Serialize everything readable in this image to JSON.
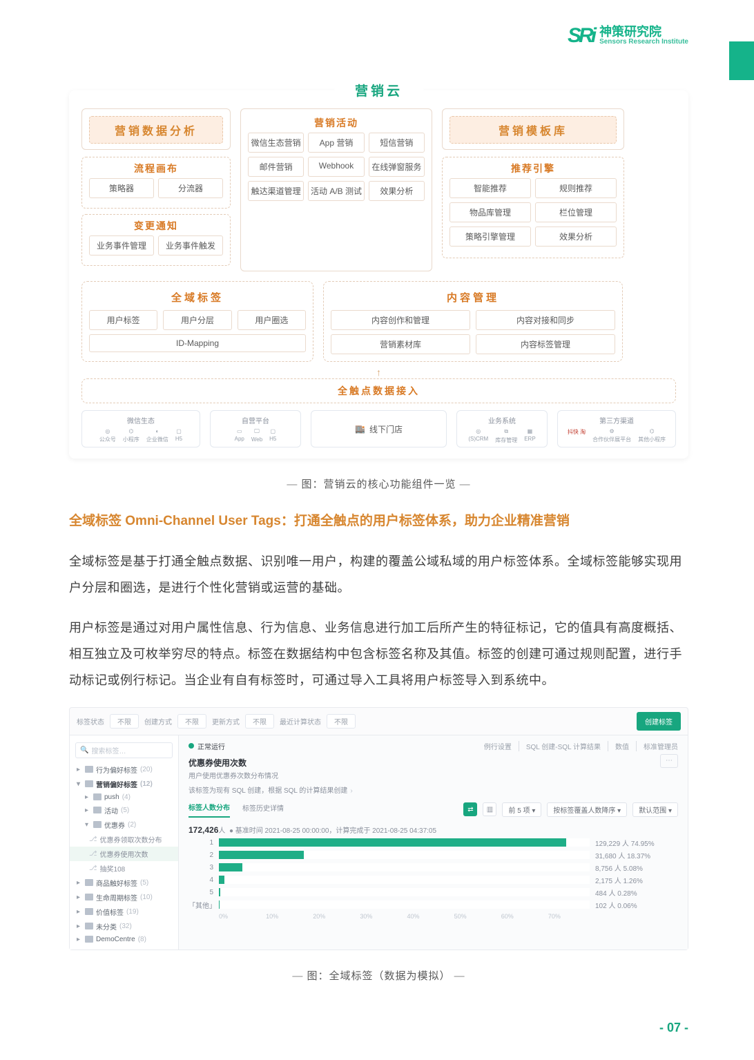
{
  "header": {
    "brand_cn": "神策研究院",
    "brand_en": "Sensors Research Institute",
    "brand_mark": "SRi"
  },
  "diagram": {
    "title": "营销云",
    "cols": {
      "analytics": {
        "header": "营销数据分析"
      },
      "templates": {
        "header": "营销模板库"
      },
      "canvas": {
        "title": "流程画布",
        "items": [
          "策略器",
          "分流器"
        ]
      },
      "change": {
        "title": "变更通知",
        "items": [
          "业务事件管理",
          "业务事件触发"
        ]
      },
      "activity": {
        "title": "营销活动",
        "items": [
          "微信生态营销",
          "App 营销",
          "短信营销",
          "邮件营销",
          "Webhook",
          "在线弹窗服务",
          "触达渠道管理",
          "活动 A/B 测试",
          "效果分析"
        ]
      },
      "recommend": {
        "title": "推荐引擎",
        "items": [
          "智能推荐",
          "规则推荐",
          "物品库管理",
          "栏位管理",
          "策略引擎管理",
          "效果分析"
        ]
      }
    },
    "tags": {
      "title": "全域标签",
      "items": [
        "用户标签",
        "用户分层",
        "用户圈选",
        "ID-Mapping"
      ]
    },
    "content": {
      "title": "内容管理",
      "items": [
        "内容创作和管理",
        "内容对接和同步",
        "营销素材库",
        "内容标签管理"
      ]
    },
    "data_in": "全触点数据接入",
    "srcs": {
      "wechat": {
        "label": "微信生态",
        "icons": [
          "公众号",
          "小程序",
          "企业微信",
          "H5"
        ]
      },
      "own": {
        "label": "自营平台",
        "icons": [
          "App",
          "Web",
          "H5"
        ]
      },
      "offline": {
        "label": "线下门店",
        "icon_name": "store-icon"
      },
      "biz": {
        "label": "业务系统",
        "icons": [
          "(S)CRM",
          "库存管理",
          "ERP"
        ]
      },
      "third": {
        "label": "第三方渠道",
        "left": "抖快 淘",
        "right_icons": [
          "合作伙伴展平台",
          "其他小程序"
        ]
      }
    }
  },
  "caption1": "图：营销云的核心功能组件一览",
  "heading": "全域标签 Omni-Channel User Tags：打通全触点的用户标签体系，助力企业精准营销",
  "para1": "全域标签是基于打通全触点数据、识别唯一用户，构建的覆盖公域私域的用户标签体系。全域标签能够实现用户分层和圈选，是进行个性化营销或运营的基础。",
  "para2": "用户标签是通过对用户属性信息、行为信息、业务信息进行加工后所产生的特征标记，它的值具有高度概括、相互独立及可枚举穷尽的特点。标签在数据结构中包含标签名称及其值。标签的创建可通过规则配置，进行手动标记或例行标记。当企业有自有标签时，可通过导入工具将用户标签导入到系统中。",
  "screenshot": {
    "filters": {
      "status_lbl": "标签状态",
      "status_val": "不限",
      "create_lbl": "创建方式",
      "create_val": "不限",
      "update_lbl": "更新方式",
      "update_val": "不限",
      "calc_lbl": "最近计算状态",
      "calc_val": "不限"
    },
    "new_btn": "创建标签",
    "search_placeholder": "搜索标签…",
    "tree": [
      {
        "t": "行为偏好标签",
        "c": "(20)",
        "type": "folder"
      },
      {
        "t": "营销偏好标签",
        "c": "(12)",
        "type": "folder",
        "bold": true,
        "open": true
      },
      {
        "t": "push",
        "c": "(4)",
        "type": "folder",
        "indent": 1
      },
      {
        "t": "活动",
        "c": "(5)",
        "type": "folder",
        "indent": 1
      },
      {
        "t": "优惠券",
        "c": "(2)",
        "type": "folder",
        "indent": 1,
        "open": true
      },
      {
        "t": "优惠券领取次数分布",
        "type": "leaf"
      },
      {
        "t": "优惠券使用次数",
        "type": "leaf",
        "active": true
      },
      {
        "t": "抽奖108",
        "type": "leaf"
      },
      {
        "t": "商品触好标签",
        "c": "(5)",
        "type": "folder"
      },
      {
        "t": "生命周期标签",
        "c": "(10)",
        "type": "folder"
      },
      {
        "t": "价值标签",
        "c": "(19)",
        "type": "folder"
      },
      {
        "t": "未分类",
        "c": "(32)",
        "type": "folder"
      },
      {
        "t": "DemoCentre",
        "c": "(8)",
        "type": "folder"
      }
    ],
    "running": "正常运行",
    "toplinks": [
      "例行设置",
      "SQL 创建-SQL 计算结果",
      "数值",
      "标准管理员"
    ],
    "title": "优惠券使用次数",
    "subtitle": "用户使用优惠券次数分布情况",
    "sqlnote": "该标签为现有 SQL 创建，根据 SQL 的计算结果创建",
    "tabs": [
      "标签人数分布",
      "标签历史详情"
    ],
    "sort_dd": "前 5 项",
    "order_dd": "按标签覆盖人数降序",
    "period_dd": "默认范围",
    "summary_n": "172,426",
    "summary_suffix": "人",
    "summary_note": "基准时间 2021-08-25 00:00:00，计算完成于 2021-08-25 04:37:05",
    "xticks": [
      "0%",
      "10%",
      "20%",
      "30%",
      "40%",
      "50%",
      "60%",
      "70%"
    ]
  },
  "chart_data": {
    "type": "bar",
    "orientation": "horizontal",
    "categories": [
      "1",
      "2",
      "3",
      "4",
      "5",
      "「其他」"
    ],
    "values_people": [
      129229,
      31680,
      8756,
      2175,
      484,
      102
    ],
    "values_pct": [
      74.95,
      18.37,
      5.08,
      1.26,
      0.28,
      0.06
    ],
    "value_labels": [
      "129,229 人 74.95%",
      "31,680 人 18.37%",
      "8,756 人 5.08%",
      "2,175 人 1.26%",
      "484 人 0.28%",
      "102 人 0.06%"
    ],
    "xlim_pct": [
      0,
      80
    ]
  },
  "caption2": "图：全域标签（数据为模拟）",
  "page_no": "- 07 -"
}
